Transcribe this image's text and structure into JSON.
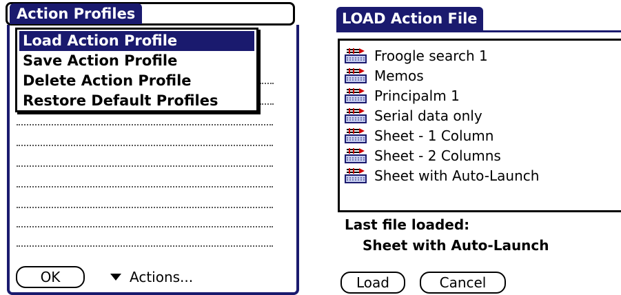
{
  "left": {
    "title": "Action Profiles",
    "menu_items": [
      {
        "label": "Load Action Profile",
        "selected": true
      },
      {
        "label": "Save Action Profile",
        "selected": false
      },
      {
        "label": "Delete Action Profile",
        "selected": false
      },
      {
        "label": "Restore Default Profiles",
        "selected": false
      }
    ],
    "ok_label": "OK",
    "actions_label": "Actions..."
  },
  "right": {
    "title": "LOAD Action File",
    "files": [
      {
        "name": "Froogle search 1",
        "icon": "action-file-icon"
      },
      {
        "name": "Memos",
        "icon": "action-file-icon"
      },
      {
        "name": "Principalm 1",
        "icon": "action-file-icon"
      },
      {
        "name": "Serial data only",
        "icon": "action-file-icon"
      },
      {
        "name": "Sheet - 1 Column",
        "icon": "action-file-icon"
      },
      {
        "name": "Sheet - 2 Columns",
        "icon": "action-file-icon"
      },
      {
        "name": "Sheet with Auto-Launch",
        "icon": "action-file-icon"
      }
    ],
    "last_file_label": "Last file loaded:",
    "last_file_value": "Sheet with Auto-Launch",
    "load_label": "Load",
    "cancel_label": "Cancel"
  },
  "colors": {
    "accent": "#1a1a6e",
    "background": "#ffffff",
    "text": "#000000"
  }
}
